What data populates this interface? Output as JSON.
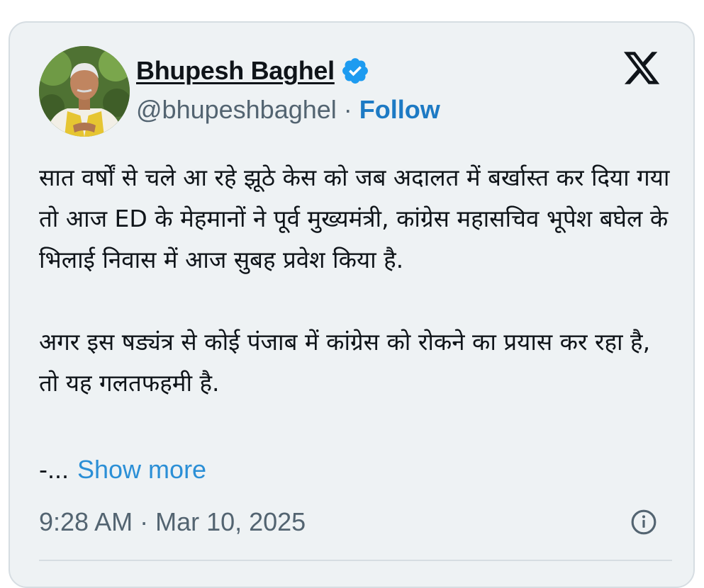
{
  "tweet": {
    "author_name": "Bhupesh Baghel",
    "author_handle": "@bhupeshbaghel",
    "separator": "·",
    "follow_label": "Follow",
    "avatar": "avatar-photo",
    "verified_icon": "verified-badge-icon",
    "platform_icon": "x-logo-icon",
    "paragraphs": [
      "सात वर्षों से चले आ रहे झूठे केस को जब अदालत में बर्खास्त कर दिया गया तो आज ED के मेहमानों ने पूर्व मुख्यमंत्री, कांग्रेस महासचिव भूपेश बघेल के भिलाई निवास में आज सुबह प्रवेश किया है.",
      "अगर इस षड्यंत्र से कोई पंजाब में कांग्रेस को रोकने का प्रयास कर रहा है, तो यह गलतफहमी है."
    ],
    "truncated_prefix": "-...",
    "show_more_label": "Show more",
    "timestamp": "9:28 AM · Mar 10, 2025",
    "info_icon": "info-icon"
  },
  "colors": {
    "card_background": "#eef2f4",
    "card_border": "#d6dde2",
    "text_primary": "#0f1419",
    "text_secondary": "#536471",
    "follow_link": "#1d7ac4",
    "show_more_link": "#2b8fd6",
    "verified_badge": "#1d9bf0"
  }
}
